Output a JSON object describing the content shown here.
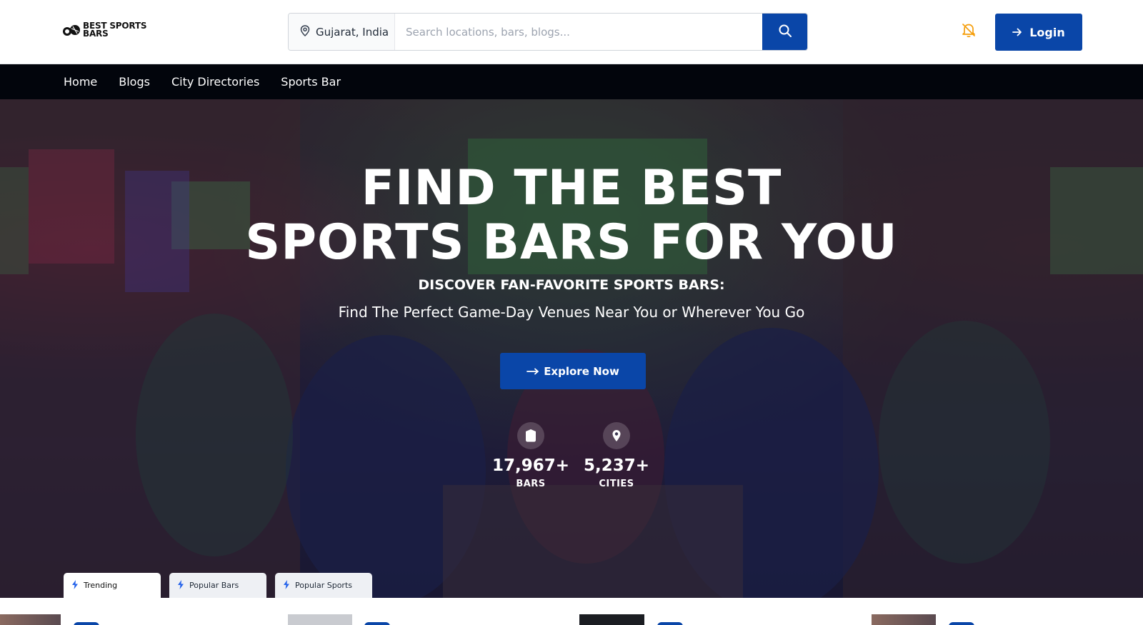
{
  "header": {
    "logo_text": "BEST SPORTS BARS",
    "location": "Gujarat, India",
    "search_placeholder": "Search locations, bars, blogs...",
    "login_label": "Login"
  },
  "nav": {
    "items": [
      "Home",
      "Blogs",
      "City Directories",
      "Sports Bar"
    ]
  },
  "hero": {
    "title_line1": "FIND THE BEST",
    "title_line2": "SPORTS BARS FOR YOU",
    "subtitle": "DISCOVER FAN-FAVORITE SPORTS BARS:",
    "tagline": "Find The Perfect Game-Day Venues Near You or Wherever You Go",
    "cta_label": "Explore Now",
    "stats": [
      {
        "value": "17,967+",
        "label": "BARS",
        "icon": "shield-icon"
      },
      {
        "value": "5,237+",
        "label": "CITIES",
        "icon": "map-pin-icon"
      }
    ]
  },
  "tabs": [
    {
      "label": "Trending",
      "icon": "bolt-icon",
      "active": true
    },
    {
      "label": "Popular Bars",
      "icon": "bolt-icon",
      "active": false
    },
    {
      "label": "Popular Sports",
      "icon": "bolt-icon",
      "active": false
    }
  ],
  "colors": {
    "primary": "#0a46a8",
    "nav_bg": "#02050c",
    "bell": "#f59e0b"
  }
}
